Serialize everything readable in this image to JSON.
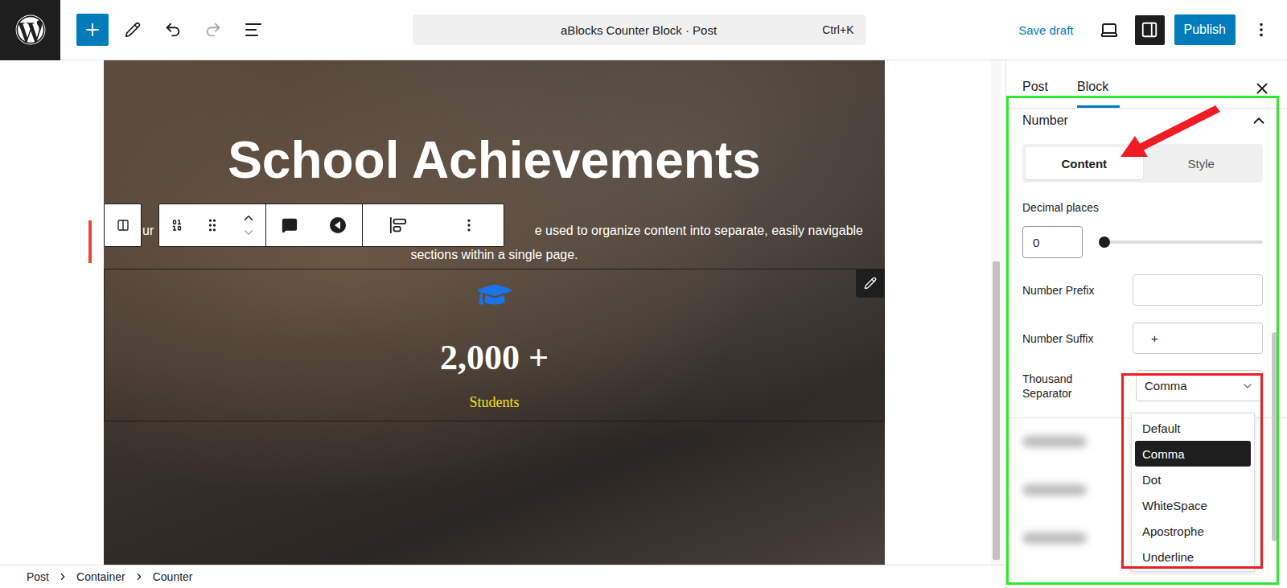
{
  "window": {
    "title": "aBlocks Counter Block · Post",
    "shortcut": "Ctrl+K"
  },
  "toolbar": {
    "save": "Save draft",
    "publish": "Publish"
  },
  "canvas": {
    "title": "School Achievements",
    "fragment": "ur",
    "lines": [
      "e used to organize content into separate, easily navigable",
      "sections within a single page."
    ],
    "counter": {
      "value": "2,000 +",
      "label": "Students"
    }
  },
  "sidebar": {
    "tabs": [
      {
        "label": "Post",
        "selected": false
      },
      {
        "label": "Block",
        "selected": true
      }
    ],
    "panel": {
      "title": "Number",
      "expanded": true
    },
    "subtabs": [
      {
        "label": "Content",
        "selected": true
      },
      {
        "label": "Style",
        "selected": false
      }
    ],
    "decimal": {
      "label": "Decimal places",
      "value": "0",
      "level": 0
    },
    "prefix": {
      "label": "Number Prefix",
      "value": ""
    },
    "suffix": {
      "label": "Number Suffix",
      "value": "+"
    },
    "separator": {
      "label": "Thousand Separator",
      "value": "Comma",
      "open": true,
      "options": [
        {
          "label": "Default",
          "selected": false
        },
        {
          "label": "Comma",
          "selected": true
        },
        {
          "label": "Dot",
          "selected": false
        },
        {
          "label": "WhiteSpace",
          "selected": false
        },
        {
          "label": "Apostrophe",
          "selected": false
        },
        {
          "label": "Underline",
          "selected": false
        }
      ]
    }
  },
  "breadcrumbs": [
    "Post",
    "Container",
    "Counter"
  ]
}
